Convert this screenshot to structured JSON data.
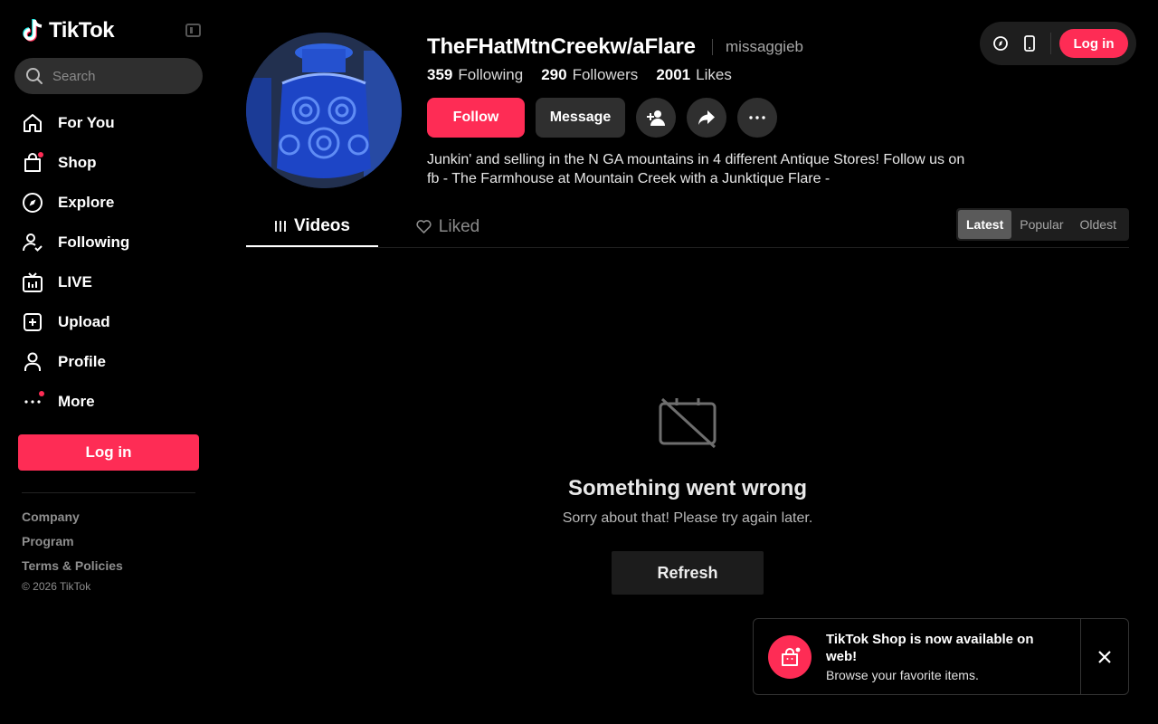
{
  "app": {
    "logo_text": "TikTok"
  },
  "search": {
    "placeholder": "Search"
  },
  "sidebar": {
    "items": [
      {
        "label": "For You",
        "icon": "home-icon"
      },
      {
        "label": "Shop",
        "icon": "shopping-bag-icon"
      },
      {
        "label": "Explore",
        "icon": "compass-icon"
      },
      {
        "label": "Following",
        "icon": "following-users-icon"
      },
      {
        "label": "LIVE",
        "icon": "live-tv-icon"
      },
      {
        "label": "Upload",
        "icon": "plus-square-icon"
      },
      {
        "label": "Profile",
        "icon": "user-icon"
      },
      {
        "label": "More",
        "icon": "more-dots-icon"
      }
    ],
    "login_label": "Log in",
    "footer_links": [
      "Company",
      "Program",
      "Terms & Policies"
    ],
    "copyright": "© 2026 TikTok"
  },
  "header": {
    "login_label": "Log in"
  },
  "profile": {
    "username": "TheFHatMtnCreekw/aFlare",
    "nickname": "missaggieb",
    "stats": [
      {
        "value": "359",
        "label": "Following"
      },
      {
        "value": "290",
        "label": "Followers"
      },
      {
        "value": "2001",
        "label": "Likes"
      }
    ],
    "follow_label": "Follow",
    "message_label": "Message",
    "bio": "Junkin' and selling in the N GA mountains in 4 different Antique Stores! Follow us on fb - The Farmhouse at Mountain Creek with a Junktique Flare -"
  },
  "tabs": [
    {
      "label": "Videos",
      "active": true
    },
    {
      "label": "Liked",
      "active": false
    }
  ],
  "sort_options": [
    {
      "label": "Latest",
      "active": true
    },
    {
      "label": "Popular",
      "active": false
    },
    {
      "label": "Oldest",
      "active": false
    }
  ],
  "error": {
    "title": "Something went wrong",
    "subtitle": "Sorry about that! Please try again later.",
    "refresh_label": "Refresh"
  },
  "toast": {
    "title": "TikTok Shop is now available on web!",
    "subtitle": "Browse your favorite items."
  },
  "colors": {
    "accent": "#fe2c55",
    "background": "#000000",
    "surface": "#2f2f2f"
  }
}
